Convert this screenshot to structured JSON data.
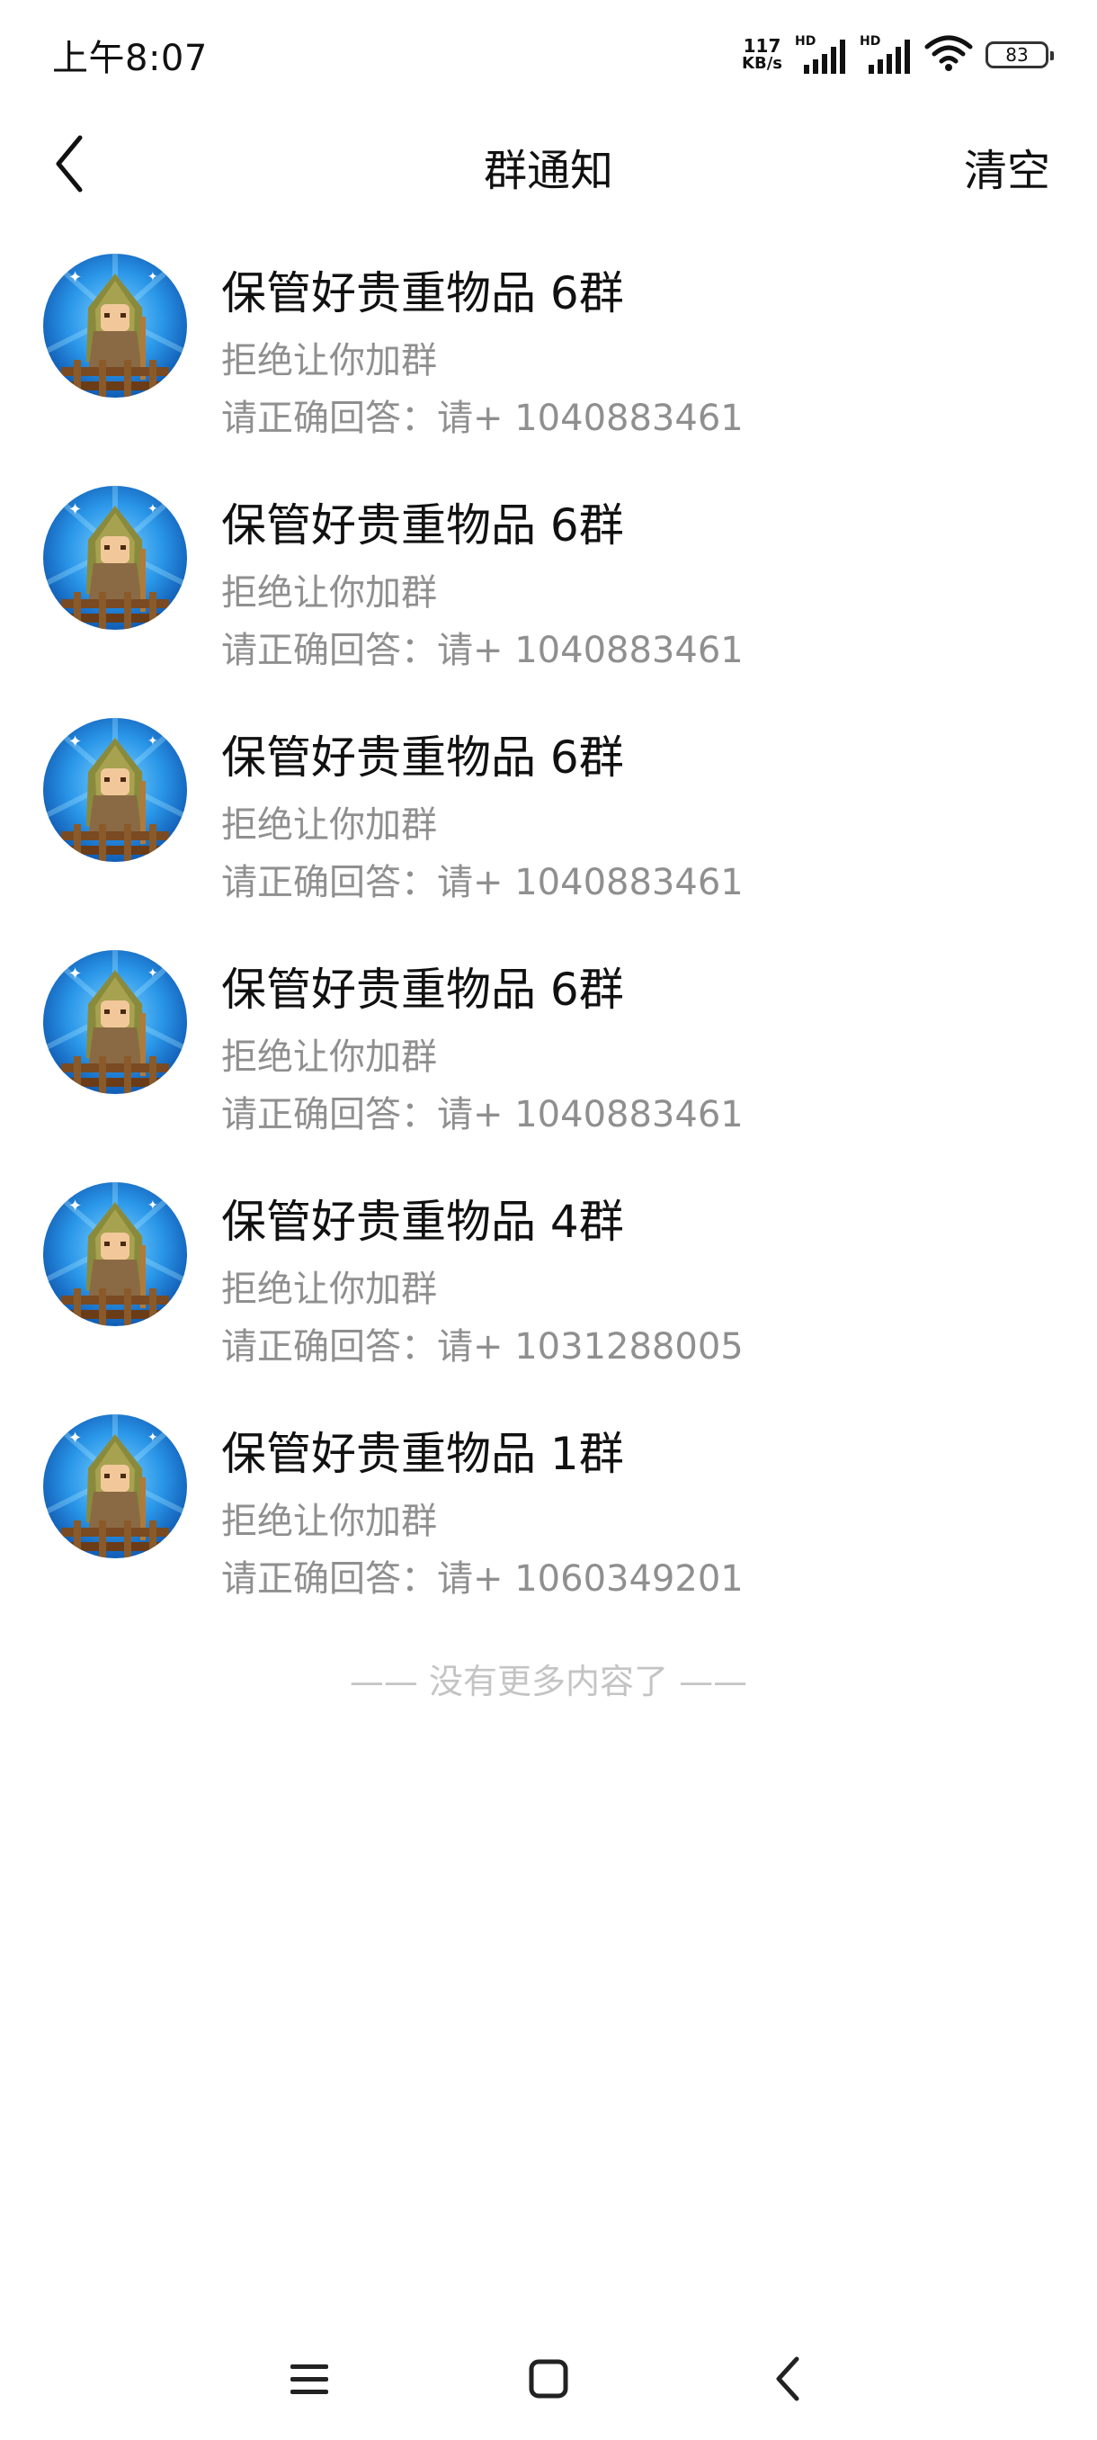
{
  "status_bar": {
    "time": "上午8:07",
    "net_speed_value": "117",
    "net_speed_unit": "KB/s",
    "sim1_label": "HD",
    "sim2_label": "HD",
    "battery": "83"
  },
  "header": {
    "title": "群通知",
    "clear_label": "清空"
  },
  "notifications": [
    {
      "title": "保管好贵重物品 6群",
      "status": "拒绝让你加群",
      "answer": "请正确回答：请+ 1040883461"
    },
    {
      "title": "保管好贵重物品 6群",
      "status": "拒绝让你加群",
      "answer": "请正确回答：请+ 1040883461"
    },
    {
      "title": "保管好贵重物品 6群",
      "status": "拒绝让你加群",
      "answer": "请正确回答：请+ 1040883461"
    },
    {
      "title": "保管好贵重物品 6群",
      "status": "拒绝让你加群",
      "answer": "请正确回答：请+ 1040883461"
    },
    {
      "title": "保管好贵重物品 4群",
      "status": "拒绝让你加群",
      "answer": "请正确回答：请+ 1031288005"
    },
    {
      "title": "保管好贵重物品 1群",
      "status": "拒绝让你加群",
      "answer": "请正确回答：请+ 1060349201"
    }
  ],
  "end_of_list": "—— 没有更多内容了 ——",
  "icons": {
    "back": "chevron-left-icon",
    "menu": "menu-icon",
    "home": "home-icon",
    "nav_back": "back-icon",
    "wifi": "wifi-icon",
    "signal": "signal-icon",
    "battery": "battery-icon"
  },
  "colors": {
    "title_text": "#111111",
    "secondary_text": "#8f8f8f",
    "end_text": "#c4c4c4",
    "avatar_blue": "#1e88e5"
  }
}
